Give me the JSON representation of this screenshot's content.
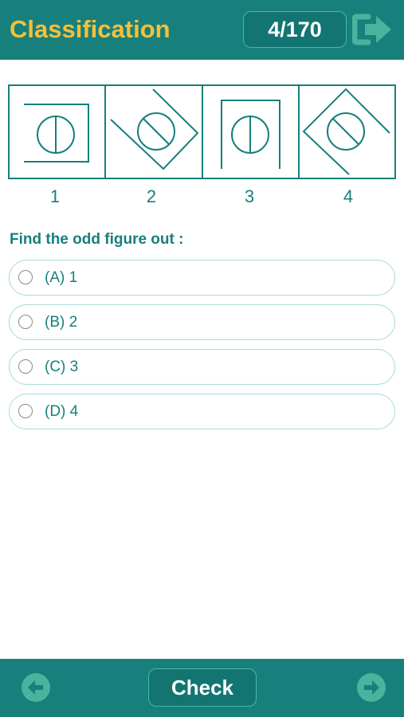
{
  "header": {
    "title": "Classification",
    "counter": "4/170",
    "exit_icon": "exit-arrow-icon"
  },
  "puzzle": {
    "figures": [
      {
        "label": "1"
      },
      {
        "label": "2"
      },
      {
        "label": "3"
      },
      {
        "label": "4"
      }
    ]
  },
  "question": {
    "prompt": "Find the odd figure out :",
    "options": [
      {
        "label": "(A) 1",
        "selected": false
      },
      {
        "label": "(B) 2",
        "selected": false
      },
      {
        "label": "(C) 3",
        "selected": false
      },
      {
        "label": "(D) 4",
        "selected": false
      }
    ]
  },
  "footer": {
    "check_label": "Check",
    "prev_icon": "arrow-left-icon",
    "next_icon": "arrow-right-icon"
  },
  "colors": {
    "primary": "#17807c",
    "title_accent": "#f5bf3a",
    "nav_button": "#49b39d",
    "option_border": "#a9dcd9"
  }
}
